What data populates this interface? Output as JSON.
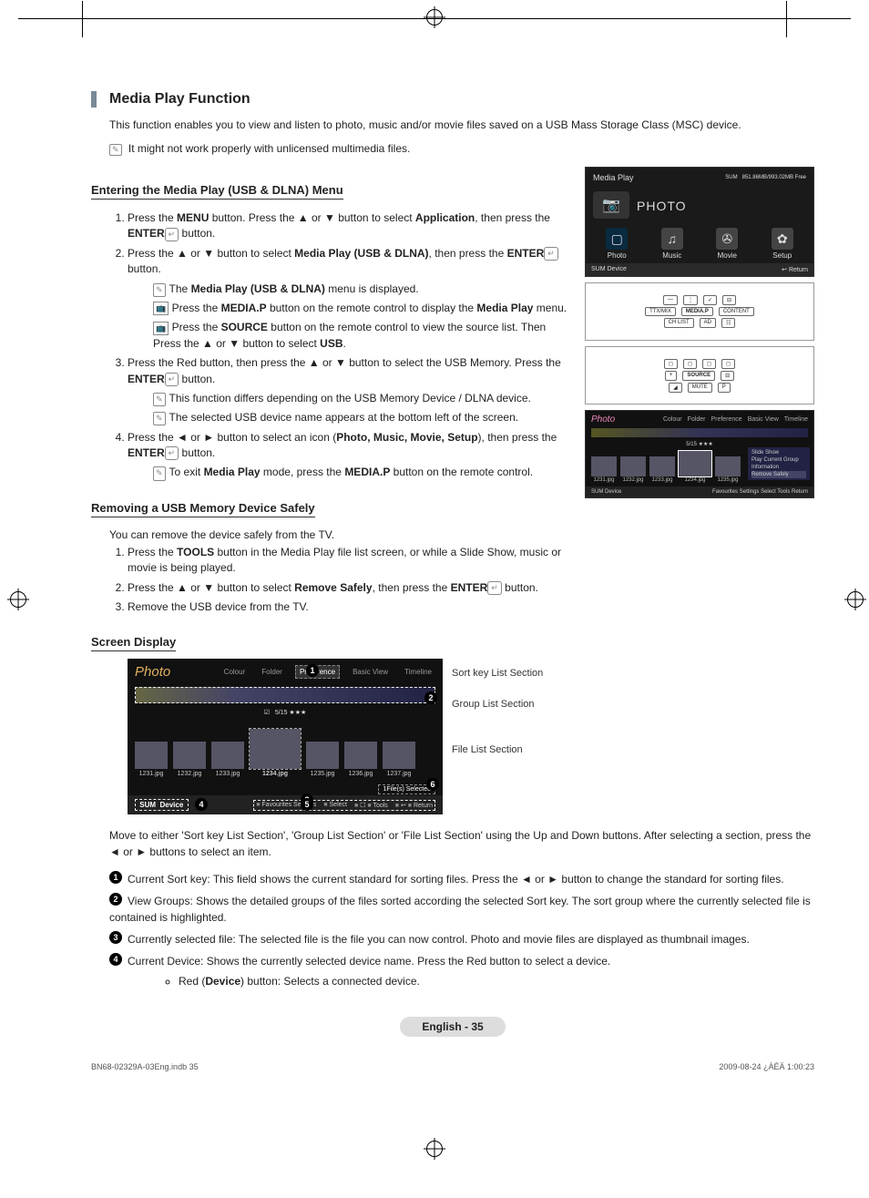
{
  "header": {
    "section_title": "Media Play Function",
    "intro": "This function enables you to view and listen to photo, music and/or movie files saved on a USB Mass Storage Class (MSC) device.",
    "intro_note": "It might not work properly with unlicensed multimedia files."
  },
  "entering": {
    "title": "Entering the Media Play (USB & DLNA) Menu",
    "step1_a": "Press the ",
    "step1_menu": "MENU",
    "step1_b": " button. Press the ▲ or ▼ button to select ",
    "step1_app": "Application",
    "step1_c": ", then press the ",
    "step1_enter": "ENTER",
    "step1_d": " button.",
    "step2_a": "Press the ▲ or ▼ button to select ",
    "step2_mp": "Media Play (USB & DLNA)",
    "step2_b": ", then press the ",
    "step2_c": " button.",
    "note2a_a": "The ",
    "note2a_mp": "Media Play (USB & DLNA)",
    "note2a_b": " menu is displayed.",
    "note2b_a": "Press the ",
    "note2b_mp": "MEDIA.P",
    "note2b_b": " button on the remote control to display the ",
    "note2b_mp2": "Media Play",
    "note2b_c": " menu.",
    "note2c_a": "Press the ",
    "note2c_src": "SOURCE",
    "note2c_b": " button on the remote control to view the source list. Then Press the ▲ or ▼ button to select ",
    "note2c_usb": "USB",
    "note2c_c": ".",
    "step3": "Press the Red button, then press the ▲ or ▼ button to select the USB Memory. Press the ",
    "step3b": " button.",
    "note3a": "This function differs depending on the USB Memory Device / DLNA device.",
    "note3b": "The selected USB device name appears at the bottom left of the screen.",
    "step4_a": "Press the ◄ or ► button to select an icon (",
    "step4_opts": "Photo, Music, Movie, Setup",
    "step4_b": "), then press the ",
    "step4_c": " button.",
    "note4_a": "To exit ",
    "note4_mp": "Media Play",
    "note4_b": " mode, press the ",
    "note4_mp2": "MEDIA.P",
    "note4_c": " button on the remote control."
  },
  "removing": {
    "title": "Removing a USB Memory Device Safely",
    "intro": "You can remove the device safely from the TV.",
    "step1_a": "Press the ",
    "step1_tools": "TOOLS",
    "step1_b": " button in the Media Play file list screen, or while a Slide Show, music or movie is being played.",
    "step2_a": "Press the ▲ or ▼ button to select ",
    "step2_rs": "Remove Safely",
    "step2_b": ", then press the ",
    "step2_c": " button.",
    "step3": "Remove the USB device from the TV."
  },
  "screen_display": {
    "title": "Screen Display",
    "labels": {
      "sortkey": "Sort key List Section",
      "group": "Group List Section",
      "file": "File List Section"
    },
    "mock": {
      "title": "Photo",
      "sort_tabs": [
        "Colour",
        "Folder",
        "Preference",
        "Basic View",
        "Timeline"
      ],
      "sel_badge": "5/15 ★★★",
      "files": [
        "1231.jpg",
        "1232.jpg",
        "1233.jpg",
        "1234.jpg",
        "1235.jpg",
        "1236.jpg",
        "1237.jpg"
      ],
      "selected_count": "1File(s) Selected",
      "bottom_left": [
        "SUM",
        "Device"
      ],
      "bottom_right": [
        "Favourites Settings",
        "Select",
        "Tools",
        "Return"
      ]
    },
    "para": "Move to either 'Sort key List Section', 'Group List Section' or 'File List Section' using the Up and Down buttons. After selecting a section, press the ◄ or ► buttons to select an item.",
    "items": [
      "Current Sort key: This field shows the current standard for sorting files. Press the ◄ or ► button to change the standard for sorting files.",
      "View Groups:  Shows the detailed groups of the files sorted according the selected Sort key. The sort group where the currently selected file is contained is highlighted.",
      "Currently selected file: The selected file is the file you can now control. Photo and movie files are displayed as thumbnail images.",
      "Current Device: Shows the currently selected device name. Press the Red button to select a device."
    ],
    "sub_a": "Red (",
    "sub_dev": "Device",
    "sub_b": ") button: Selects a connected device."
  },
  "mp_panel": {
    "title": "Media Play",
    "sum": "SUM",
    "free": "851.86MB/993.02MB Free",
    "photo_big": "PHOTO",
    "cats": [
      "Photo",
      "Music",
      "Movie",
      "Setup"
    ],
    "foot_l": "SUM   Device",
    "foot_r": "Return"
  },
  "remote": {
    "r1": [
      "—",
      "⋮",
      "✓",
      "⊟"
    ],
    "r2": [
      "TTX/MIX",
      "MEDIA.P",
      "CONTENT"
    ],
    "r3": [
      "CH LIST",
      "AD",
      "☷"
    ],
    "r4": [
      "◻",
      "◻",
      "◻",
      "◻"
    ],
    "r5": [
      "+",
      "SOURCE",
      "⊟"
    ],
    "r6": [
      "◢",
      "MUTE",
      "P"
    ]
  },
  "preview": {
    "title": "Photo",
    "tabs": [
      "Colour",
      "Folder",
      "Preference",
      "Basic View",
      "Timeline"
    ],
    "badge": "5/15 ★★★",
    "files": [
      "1231.jpg",
      "1232.jpg",
      "1233.jpg",
      "1234.jpg",
      "1235.jpg"
    ],
    "context": [
      "Slide Show",
      "Play Current Group",
      "Information",
      "Remove Safely"
    ],
    "foot_l": "SUM  Device",
    "foot_r": "Favourites Settings  Select  Tools  Return"
  },
  "footer": {
    "page": "English - 35",
    "doc": "BN68-02329A-03Eng.indb   35",
    "date": "2009-08-24   ¿ÀÈÄ 1:00:23"
  }
}
